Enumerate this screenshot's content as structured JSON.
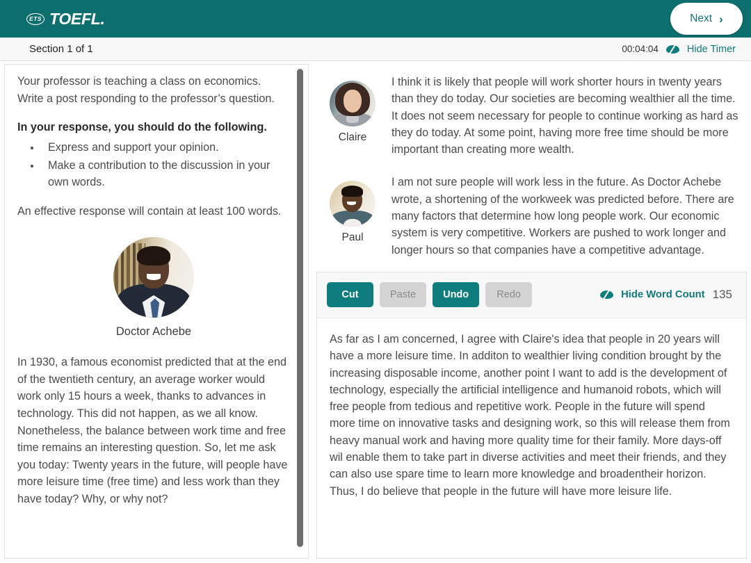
{
  "header": {
    "logo_badge": "ETS",
    "logo_word": "TOEFL.",
    "next_label": "Next",
    "next_icon": "chevron-right-icon"
  },
  "section_bar": {
    "section_label": "Section 1 of 1",
    "timer_value": "00:04:04",
    "hide_timer_label": "Hide Timer",
    "hide_timer_icon": "eye-slash-icon"
  },
  "prompt": {
    "intro": "Your professor is teaching a class on economics. Write a post responding to the professor’s question.",
    "instruction_heading": "In your response, you should do the following.",
    "bullets": [
      "Express and support your opinion.",
      "Make a contribution to the discussion in your own words."
    ],
    "length_note": "An effective response will contain at least 100 words.",
    "professor_name": "Doctor Achebe",
    "professor_avatar": "professor-portrait",
    "passage": "In 1930, a famous economist predicted that at the end of the twentieth century, an average worker would work only 15 hours a week, thanks to advances in technology. This did not happen, as we all know. Nonetheless, the balance between work time and free time remains an interesting question. So, let me ask you today: Twenty years in the future, will people have more leisure time (free time) and less work than they have today? Why, or why not?"
  },
  "discussion": {
    "posts": [
      {
        "author": "Claire",
        "avatar": "claire-portrait",
        "text": "I think it is likely that people will work shorter hours in twenty years than they do today. Our societies are becoming wealthier all the time. It does not seem necessary for people to continue working as hard as they do today. At some point, having more free time should be more important than creating more wealth."
      },
      {
        "author": "Paul",
        "avatar": "paul-portrait",
        "text": "I am not sure people will work less in the future. As Doctor Achebe wrote, a shortening of the workweek was predicted before. There are many factors that determine how long people work. Our economic system is very competitive. Workers are pushed to work longer and longer hours so that companies have a competitive advantage."
      }
    ]
  },
  "editor": {
    "toolbar": {
      "cut_label": "Cut",
      "paste_label": "Paste",
      "undo_label": "Undo",
      "redo_label": "Redo",
      "hide_word_count_label": "Hide Word Count",
      "hide_word_count_icon": "eye-slash-icon",
      "word_count": "135"
    },
    "response_text": "As far as I am concerned, I agree with Claire's idea that people in 20 years will have a more leisure time. In additon to wealthier living condition brought by the increasing disposable income, another point I want to add is the development of technology, especially the artificial intelligence and humanoid robots, which will free people from tedious and repetitive work. People in the future will spend more time on innovative tasks and designing work, so this will release them from heavy manual work and having more quality time for their family. More days-off wil enable them to take part in diverse activities and meet their friends, and they can also use spare time to learn more knowledge and broadentheir horizon. Thus, I do believe that people in the future will have more leisure life."
  },
  "colors": {
    "brand_teal": "#0d6e6e",
    "accent_teal": "#0f7d7d",
    "link_teal": "#10787d",
    "body_text": "#4a4a4a",
    "disabled_gray": "#d4d4d4"
  }
}
